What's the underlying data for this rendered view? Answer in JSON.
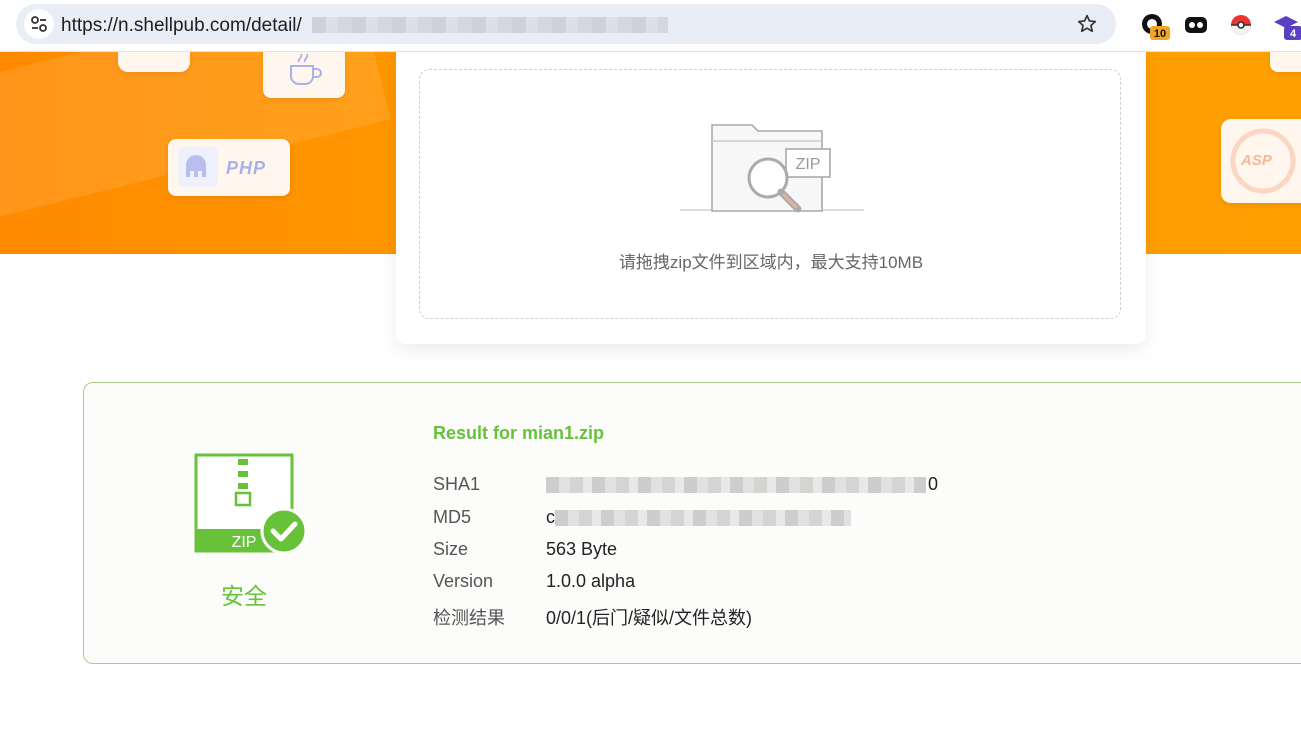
{
  "browser": {
    "url": "https://n.shellpub.com/detail/",
    "extensions": {
      "badge1": "10",
      "badge4": "4"
    }
  },
  "hero": {
    "php_label": "PHP",
    "asp_label": "ASP"
  },
  "upload": {
    "zip_tag": "ZIP",
    "hint": "请拖拽zip文件到区域内，最大支持10MB"
  },
  "result": {
    "status_label": "安全",
    "zip_badge": "ZIP",
    "title": "Result for mian1.zip",
    "rows": [
      {
        "key": "SHA1",
        "value_tail": "0"
      },
      {
        "key": "MD5",
        "value_head": "c"
      },
      {
        "key": "Size",
        "value": "563 Byte"
      },
      {
        "key": "Version",
        "value": "1.0.0 alpha"
      },
      {
        "key": "检测结果",
        "value": "0/0/1(后门/疑似/文件总数)"
      }
    ]
  },
  "colors": {
    "accent_orange": "#ff9a00",
    "success_green": "#67c23a",
    "card_border": "#a7cb8e"
  }
}
